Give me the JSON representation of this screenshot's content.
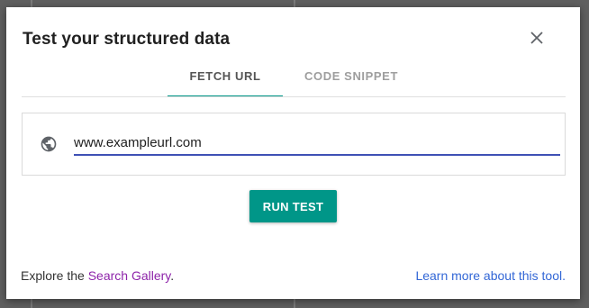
{
  "dialog": {
    "title": "Test your structured data"
  },
  "tabs": [
    {
      "label": "FETCH URL",
      "active": true
    },
    {
      "label": "CODE SNIPPET",
      "active": false
    }
  ],
  "url_field": {
    "value": "www.exampleurl.com",
    "icon": "globe-icon"
  },
  "run_button": {
    "label": "RUN TEST"
  },
  "footer": {
    "explore_prefix": "Explore the",
    "search_gallery_link": "Search Gallery",
    "explore_suffix": ".",
    "learn_more_link": "Learn more about this tool."
  },
  "colors": {
    "accent": "#009688",
    "input_focus": "#3f51b5",
    "link_blue": "#3367d6",
    "link_purple": "#8e24aa"
  }
}
